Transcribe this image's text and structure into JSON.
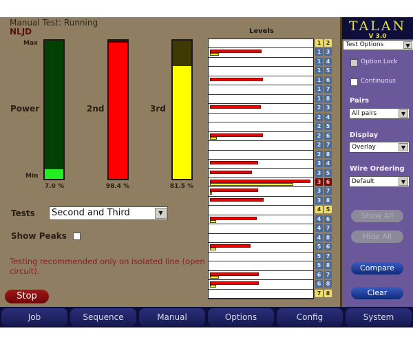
{
  "status": "Manual Test: Running",
  "mode": "NLJD",
  "meters": {
    "max_label": "Max",
    "min_label": "Min",
    "items": [
      {
        "label": "Power",
        "percent": 7.0,
        "text": "7.0 %",
        "fill": "#22ee22",
        "bg": "#034003"
      },
      {
        "label": "2nd",
        "percent": 98.4,
        "text": "98.4 %",
        "fill": "#ff0000",
        "bg": "#4a0000"
      },
      {
        "label": "3rd",
        "percent": 81.5,
        "text": "81.5 %",
        "fill": "#ffff00",
        "bg": "#3e3a05"
      }
    ]
  },
  "tests": {
    "label": "Tests",
    "value": "Second and Third"
  },
  "show_peaks": {
    "label": "Show Peaks",
    "checked": false
  },
  "warning": "Testing recommended only on isolated line (open circuit).",
  "stop_label": "Stop",
  "levels": {
    "title": "Levels",
    "rows": [
      {
        "a": "1",
        "b": "2",
        "state": "yellow",
        "red": 0,
        "yellow": 0
      },
      {
        "a": "1",
        "b": "3",
        "state": "blue",
        "red": 51,
        "yellow": 9
      },
      {
        "a": "1",
        "b": "4",
        "state": "blue",
        "red": 0,
        "yellow": 0
      },
      {
        "a": "1",
        "b": "5",
        "state": "blue",
        "red": 0,
        "yellow": 0
      },
      {
        "a": "1",
        "b": "6",
        "state": "blue",
        "red": 52,
        "yellow": 0
      },
      {
        "a": "1",
        "b": "7",
        "state": "blue",
        "red": 0,
        "yellow": 0
      },
      {
        "a": "1",
        "b": "8",
        "state": "blue",
        "red": 0,
        "yellow": 0
      },
      {
        "a": "2",
        "b": "3",
        "state": "blue",
        "red": 50,
        "yellow": 0
      },
      {
        "a": "2",
        "b": "4",
        "state": "blue",
        "red": 0,
        "yellow": 0
      },
      {
        "a": "2",
        "b": "5",
        "state": "blue",
        "red": 0,
        "yellow": 0
      },
      {
        "a": "2",
        "b": "6",
        "state": "blue",
        "red": 52,
        "yellow": 7
      },
      {
        "a": "2",
        "b": "7",
        "state": "blue",
        "red": 0,
        "yellow": 0
      },
      {
        "a": "2",
        "b": "8",
        "state": "blue",
        "red": 0,
        "yellow": 0
      },
      {
        "a": "3",
        "b": "4",
        "state": "blue",
        "red": 47,
        "yellow": 0
      },
      {
        "a": "3",
        "b": "5",
        "state": "blue",
        "red": 41,
        "yellow": 0
      },
      {
        "a": "3",
        "b": "6",
        "state": "red",
        "red": 98.4,
        "yellow": 81.5
      },
      {
        "a": "3",
        "b": "7",
        "state": "blue",
        "red": 47,
        "yellow": 2
      },
      {
        "a": "3",
        "b": "8",
        "state": "blue",
        "red": 53,
        "yellow": 0
      },
      {
        "a": "4",
        "b": "5",
        "state": "yellow",
        "red": 0,
        "yellow": 0
      },
      {
        "a": "4",
        "b": "6",
        "state": "blue",
        "red": 46,
        "yellow": 6
      },
      {
        "a": "4",
        "b": "7",
        "state": "blue",
        "red": 0,
        "yellow": 0
      },
      {
        "a": "4",
        "b": "8",
        "state": "blue",
        "red": 0,
        "yellow": 0
      },
      {
        "a": "5",
        "b": "6",
        "state": "blue",
        "red": 40,
        "yellow": 6
      },
      {
        "a": "5",
        "b": "7",
        "state": "blue",
        "red": 0,
        "yellow": 0
      },
      {
        "a": "5",
        "b": "8",
        "state": "blue",
        "red": 0,
        "yellow": 0
      },
      {
        "a": "6",
        "b": "7",
        "state": "blue",
        "red": 48,
        "yellow": 9
      },
      {
        "a": "6",
        "b": "8",
        "state": "blue",
        "red": 48,
        "yellow": 6
      },
      {
        "a": "7",
        "b": "8",
        "state": "yellow",
        "red": 0,
        "yellow": 0
      }
    ]
  },
  "side": {
    "logo": "TALAN",
    "version": "V 3.0",
    "options_select": "Test Options",
    "option_lock": "Option Lock",
    "continuous": "Continuous",
    "pairs_label": "Pairs",
    "pairs_value": "All pairs",
    "display_label": "Display",
    "display_value": "Overlay",
    "wire_label": "Wire Ordering",
    "wire_value": "Default",
    "show_all": "Show All",
    "hide_all": "Hide All",
    "compare": "Compare",
    "clear": "Clear"
  },
  "nav": [
    "Job",
    "Sequence",
    "Manual",
    "Options",
    "Config",
    "System"
  ]
}
